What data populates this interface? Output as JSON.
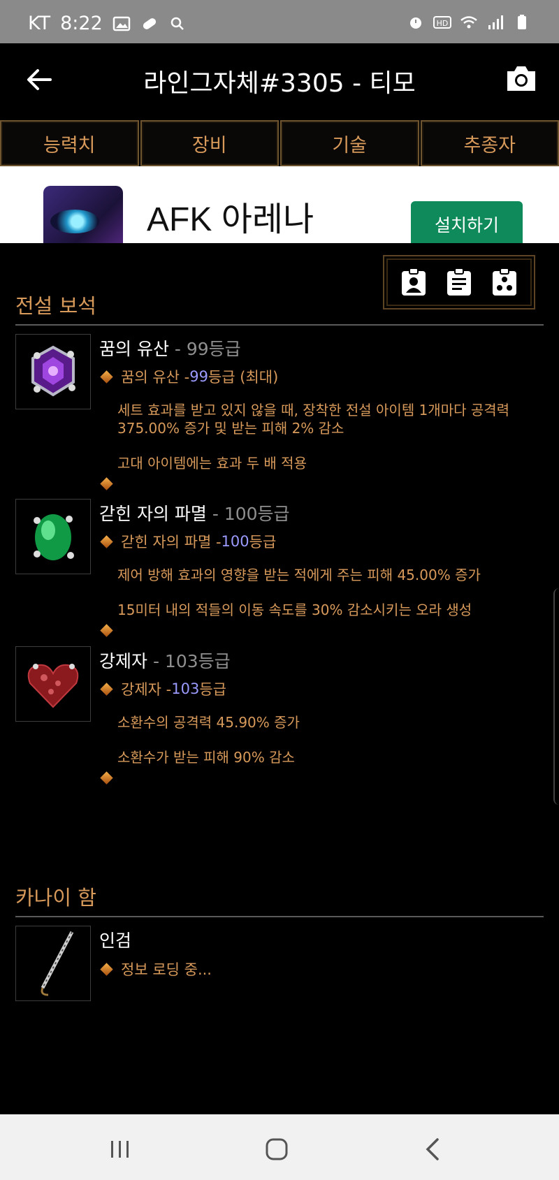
{
  "status_bar": {
    "carrier": "KT",
    "time": "8:22"
  },
  "header": {
    "title": "라인그자체#3305 - 티모"
  },
  "tabs": [
    "능력치",
    "장비",
    "기술",
    "추종자"
  ],
  "ad": {
    "title": "AFK 아레나",
    "install_label": "설치하기"
  },
  "sections": {
    "legendary_gems": {
      "title": "전설 보석"
    },
    "kanai_cube": {
      "title": "카나이 함"
    }
  },
  "gems": [
    {
      "name": "꿈의 유산",
      "grade": " - 99등급",
      "line_name": "꿈의 유산 - ",
      "line_rank": "99",
      "line_suffix": "등급 (최대)",
      "desc": [
        "세트 효과를 받고 있지 않을 때, 장착한 전설 아이템 1개마다 공격력 375.00% 증가 및 받는 피해 2% 감소",
        "고대 아이템에는 효과 두 배 적용"
      ]
    },
    {
      "name": "갇힌 자의 파멸",
      "grade": " - 100등급",
      "line_name": "갇힌 자의 파멸 - ",
      "line_rank": "100",
      "line_suffix": "등급",
      "desc": [
        "제어 방해 효과의 영향을 받는 적에게 주는 피해 45.00% 증가",
        "15미터 내의 적들의 이동 속도를 30% 감소시키는 오라 생성"
      ]
    },
    {
      "name": "강제자",
      "grade": " - 103등급",
      "line_name": "강제자 - ",
      "line_rank": "103",
      "line_suffix": "등급",
      "desc": [
        "소환수의 공격력 45.90% 증가",
        "소환수가 받는 피해 90% 감소"
      ]
    }
  ],
  "cube": [
    {
      "name": "인검",
      "status": "정보 로딩 중..."
    }
  ]
}
